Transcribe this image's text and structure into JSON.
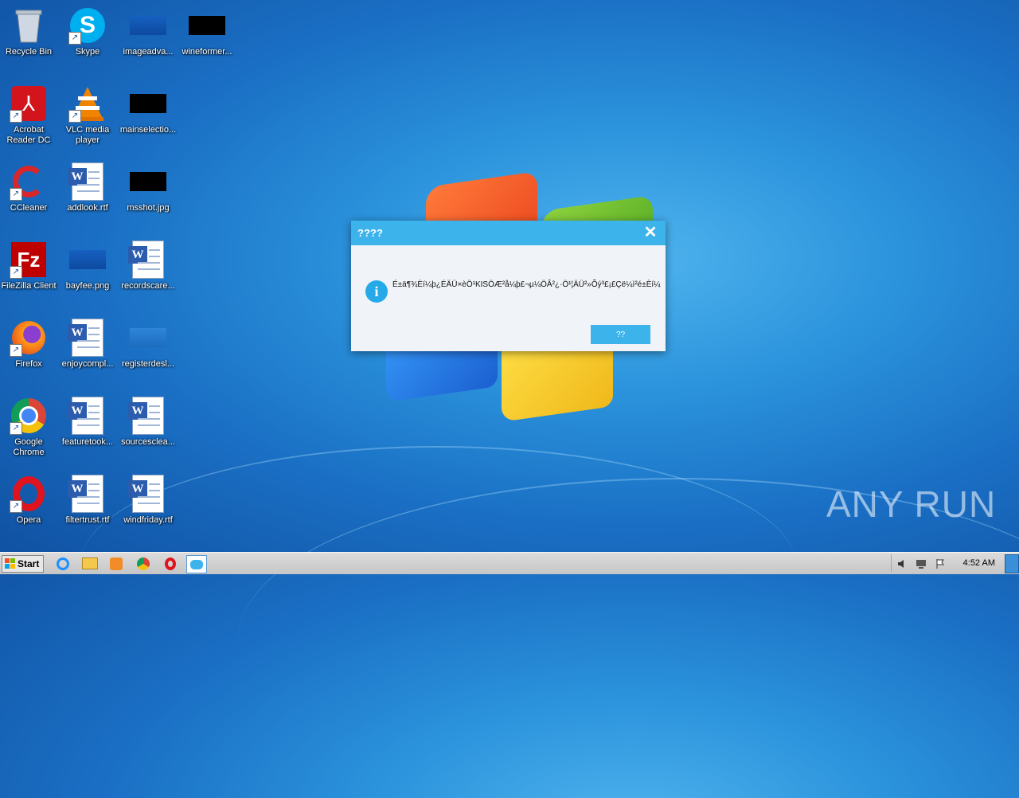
{
  "desktop": {
    "icons": [
      {
        "label": "Recycle Bin",
        "icon": "recycle-bin-icon"
      },
      {
        "label": "Skype",
        "icon": "skype-icon"
      },
      {
        "label": "imageadva...",
        "icon": "image-file-icon"
      },
      {
        "label": "wineformer...",
        "icon": "image-file-icon"
      },
      {
        "label": "Acrobat Reader DC",
        "icon": "acrobat-icon"
      },
      {
        "label": "VLC media player",
        "icon": "vlc-icon"
      },
      {
        "label": "mainselectio...",
        "icon": "image-file-icon"
      },
      {
        "label": "CCleaner",
        "icon": "ccleaner-icon"
      },
      {
        "label": "addlook.rtf",
        "icon": "word-doc-icon"
      },
      {
        "label": "msshot.jpg",
        "icon": "image-file-icon"
      },
      {
        "label": "FileZilla Client",
        "icon": "filezilla-icon"
      },
      {
        "label": "bayfee.png",
        "icon": "image-file-icon"
      },
      {
        "label": "recordscare...",
        "icon": "word-doc-icon"
      },
      {
        "label": "Firefox",
        "icon": "firefox-icon"
      },
      {
        "label": "enjoycompl...",
        "icon": "word-doc-icon"
      },
      {
        "label": "registerdesl...",
        "icon": "image-file-icon"
      },
      {
        "label": "Google Chrome",
        "icon": "chrome-icon"
      },
      {
        "label": "featuretook...",
        "icon": "word-doc-icon"
      },
      {
        "label": "sourcesclea...",
        "icon": "word-doc-icon"
      },
      {
        "label": "Opera",
        "icon": "opera-icon"
      },
      {
        "label": "filtertrust.rtf",
        "icon": "word-doc-icon"
      },
      {
        "label": "windfriday.rtf",
        "icon": "word-doc-icon"
      }
    ]
  },
  "dialog": {
    "title": "????",
    "message": "É±ä¶¾Èí¼þ¿ÉÄÜ×èÖ¹KISÖÆ²å¼þ£¬µ¼ÖÂ²¿·Ö¹¦ÄÜ²»Õý³£¡£Çë¼ì²é±Èí¼",
    "ok_label": "??",
    "close_glyph": "✕",
    "info_glyph": "i"
  },
  "watermark": "ANY RUN",
  "taskbar": {
    "start_label": "Start",
    "pinned": [
      "ie-icon",
      "explorer-icon",
      "media-player-icon",
      "chrome-icon",
      "opera-icon",
      "dialog-app-icon"
    ],
    "clock": "4:52 AM"
  },
  "colors": {
    "dialog_accent": "#3db3ec",
    "taskbar": "#d4d4d4"
  }
}
